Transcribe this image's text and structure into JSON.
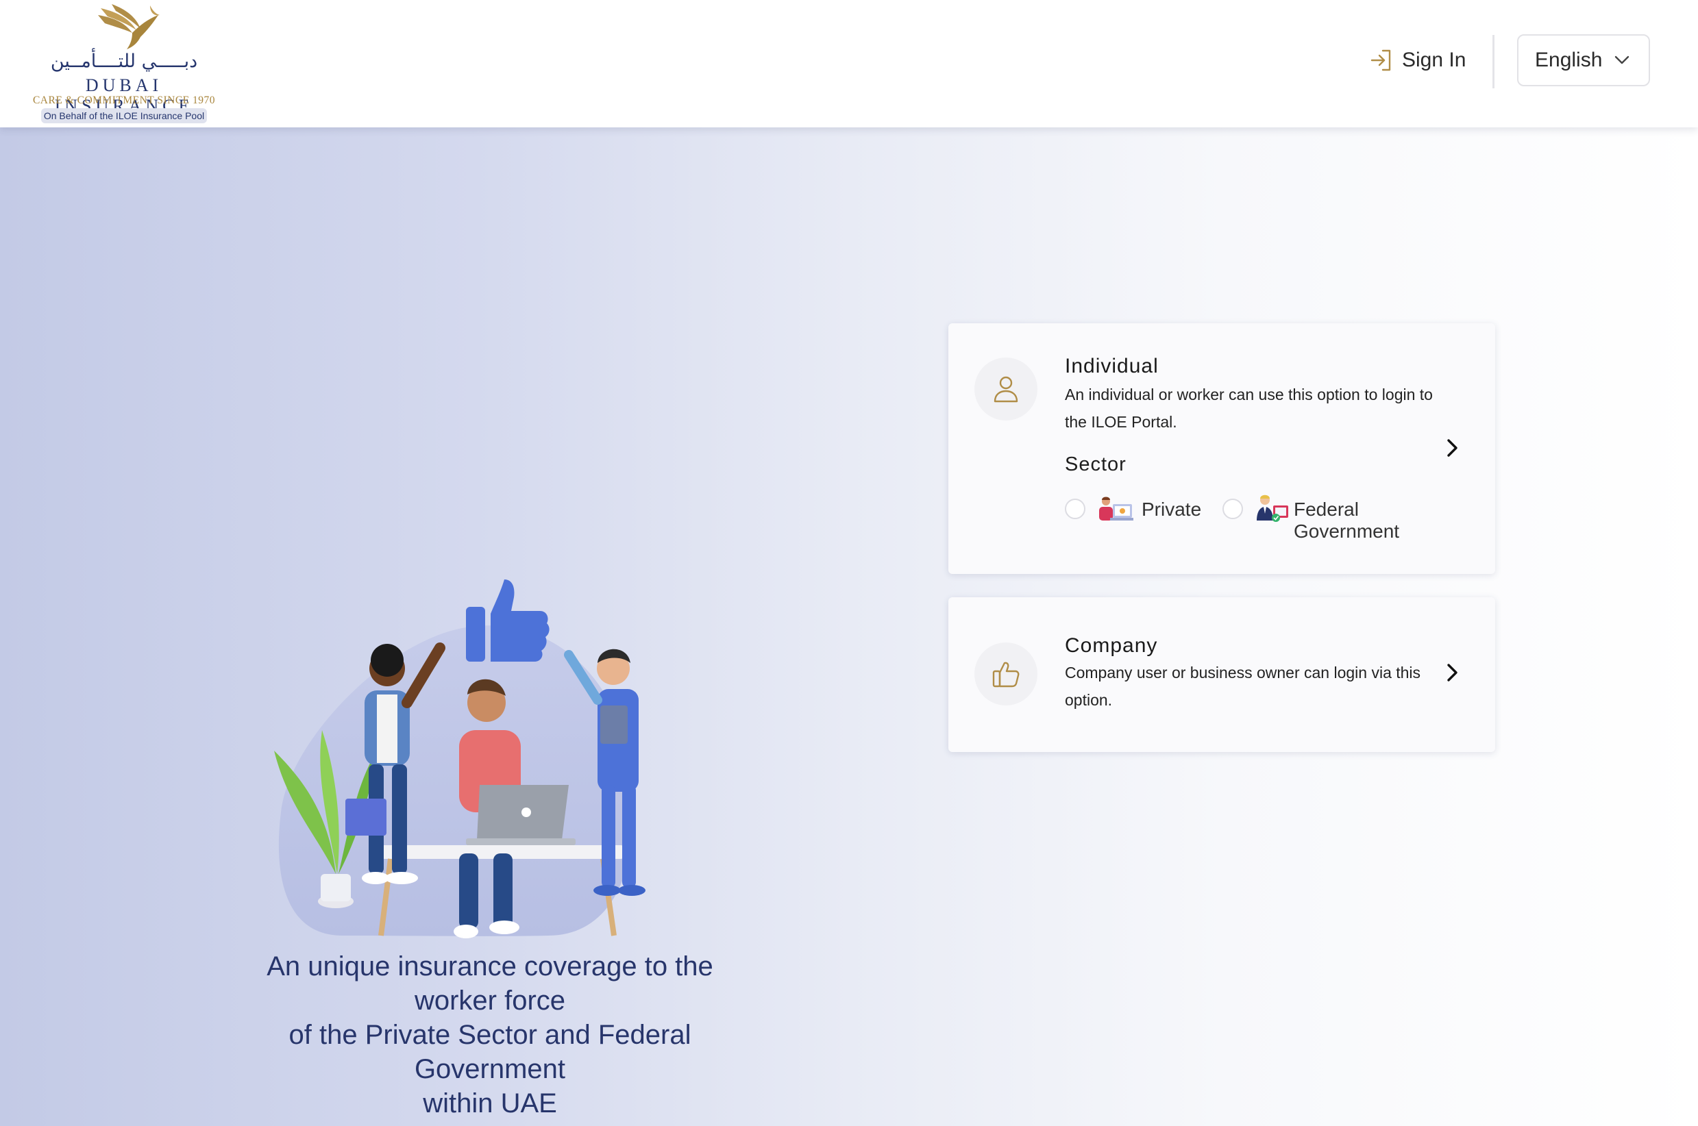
{
  "header": {
    "logo": {
      "arabic": "دبـــــي للتــــأمــين",
      "name": "DUBAI INSURANCE",
      "tagline": "CARE & COMMITMENT SINCE 1970",
      "pill": "On Behalf of the ILOE Insurance Pool"
    },
    "sign_in_label": "Sign In",
    "language": {
      "selected": "English"
    }
  },
  "hero": {
    "tagline": [
      "An unique insurance coverage to the",
      "worker force",
      "of the Private Sector and Federal",
      "Government",
      "within UAE"
    ]
  },
  "options": {
    "individual": {
      "icon": "user-icon",
      "title": "Individual",
      "description": "An individual or worker can use this option to login to the ILOE Portal.",
      "sector_label": "Sector",
      "sectors": [
        {
          "label": "Private",
          "icon": "private-sector-icon",
          "selected": false
        },
        {
          "label": "Federal Government",
          "icon": "federal-government-icon",
          "selected": false
        }
      ]
    },
    "company": {
      "icon": "thumbs-up-icon",
      "title": "Company",
      "description": "Company user or business owner can login via this option."
    }
  },
  "colors": {
    "brand_navy": "#26366e",
    "brand_gold": "#a8853c",
    "tagline_text": "#27356b"
  }
}
